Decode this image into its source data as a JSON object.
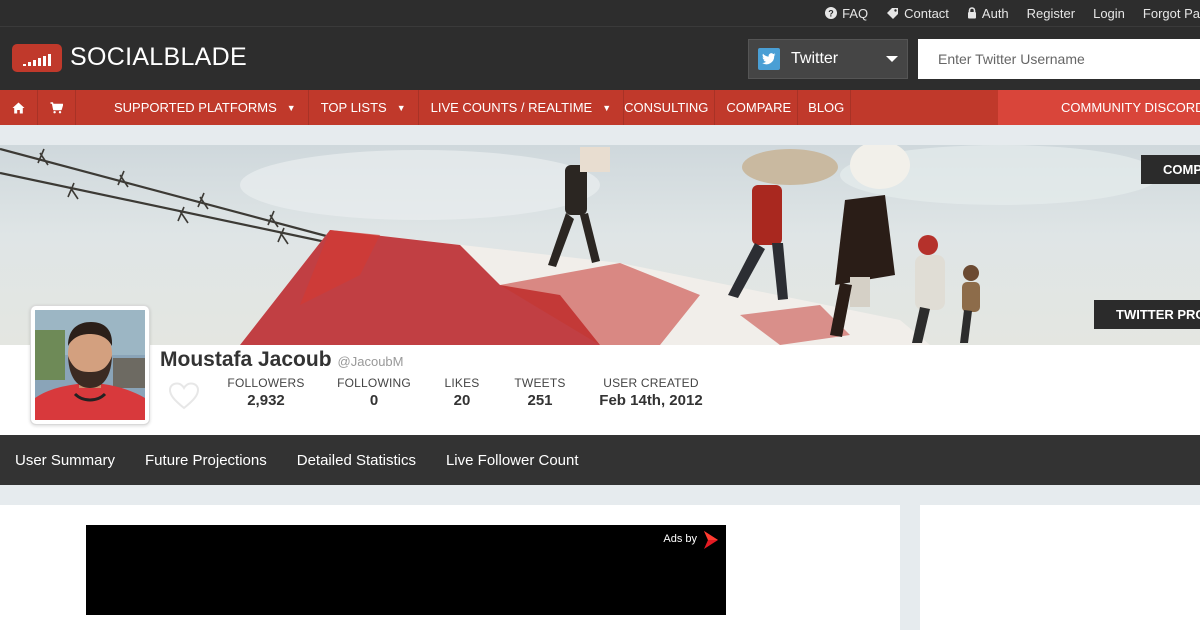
{
  "util_bar": {
    "faq": "FAQ",
    "contact": "Contact",
    "auth": "Auth",
    "register": "Register",
    "login": "Login",
    "forgot": "Forgot Pa"
  },
  "header": {
    "logo_text": "SOCIALBLADE",
    "platform": "Twitter",
    "search_placeholder": "Enter Twitter Username"
  },
  "nav": {
    "items": [
      "SUPPORTED PLATFORMS",
      "TOP LISTS",
      "LIVE COUNTS / REALTIME",
      "CONSULTING",
      "COMPARE",
      "BLOG"
    ],
    "dropdown_marker": "▼",
    "discord": "COMMUNITY DISCORD"
  },
  "banner": {
    "compare_button": "COMPA",
    "profile_button": "TWITTER PROF"
  },
  "profile": {
    "name": "Moustafa Jacoub",
    "handle": "@JacoubM",
    "stats": [
      {
        "label": "FOLLOWERS",
        "value": "2,932"
      },
      {
        "label": "FOLLOWING",
        "value": "0"
      },
      {
        "label": "LIKES",
        "value": "20"
      },
      {
        "label": "TWEETS",
        "value": "251"
      },
      {
        "label": "USER CREATED",
        "value": "Feb 14th, 2012"
      }
    ]
  },
  "subnav": {
    "items": [
      "User Summary",
      "Future Projections",
      "Detailed Statistics",
      "Live Follower Count"
    ]
  },
  "ad": {
    "label": "Ads by"
  },
  "colors": {
    "brand_red": "#c0392b",
    "dark_bar": "#2d2d2d",
    "twitter_blue": "#4a9fd5"
  }
}
